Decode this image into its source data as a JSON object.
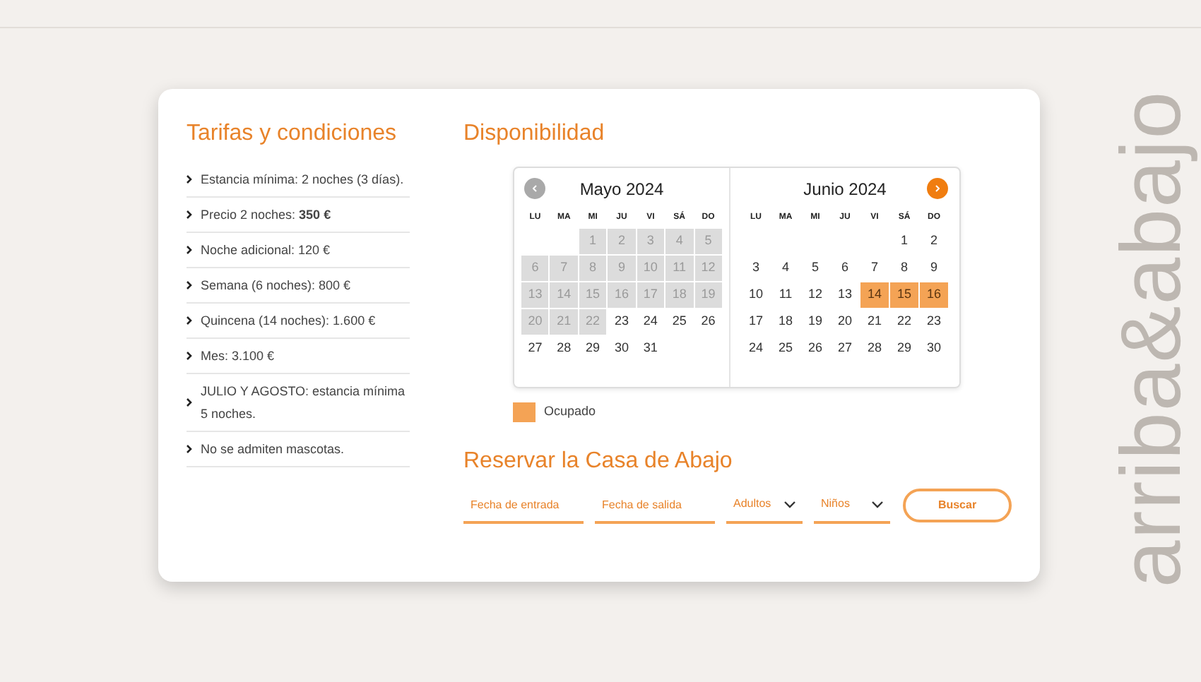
{
  "brand": "arriba&abajo",
  "rates": {
    "title": "Tarifas y condiciones",
    "items": [
      "Estancia mínima: 2 noches (3 días).",
      "Precio 2 noches: **350 €**",
      "Noche adicional: 120 €",
      "Semana (6 noches): 800 €",
      "Quincena (14 noches): 1.600 €",
      "Mes: 3.100 €",
      "JULIO Y AGOSTO: estancia mínima 5 noches.",
      "No se admiten mascotas."
    ]
  },
  "availability": {
    "title": "Disponibilidad",
    "prev_enabled": false,
    "next_enabled": true,
    "months": [
      {
        "title": "Mayo 2024",
        "weekdays": [
          "LU",
          "MA",
          "MI",
          "JU",
          "VI",
          "SÁ",
          "DO"
        ],
        "weeks": [
          [
            {
              "d": "1",
              "disabled": true,
              "occupied": false
            },
            {
              "d": "2",
              "disabled": true,
              "occupied": false
            },
            {
              "d": "3",
              "disabled": true,
              "occupied": false
            },
            {
              "d": "4",
              "disabled": true,
              "occupied": false
            },
            {
              "d": "5",
              "disabled": true,
              "occupied": false
            }
          ],
          [
            {
              "d": "6",
              "disabled": true,
              "occupied": false
            },
            {
              "d": "7",
              "disabled": true,
              "occupied": false
            },
            {
              "d": "8",
              "disabled": true,
              "occupied": false
            },
            {
              "d": "9",
              "disabled": true,
              "occupied": false
            },
            {
              "d": "10",
              "disabled": true,
              "occupied": false
            },
            {
              "d": "11",
              "disabled": true,
              "occupied": false
            },
            {
              "d": "12",
              "disabled": true,
              "occupied": false
            }
          ],
          [
            {
              "d": "13",
              "disabled": true,
              "occupied": false
            },
            {
              "d": "14",
              "disabled": true,
              "occupied": false
            },
            {
              "d": "15",
              "disabled": true,
              "occupied": false
            },
            {
              "d": "16",
              "disabled": true,
              "occupied": false
            },
            {
              "d": "17",
              "disabled": true,
              "occupied": false
            },
            {
              "d": "18",
              "disabled": true,
              "occupied": false
            },
            {
              "d": "19",
              "disabled": true,
              "occupied": false
            }
          ],
          [
            {
              "d": "20",
              "disabled": true,
              "occupied": false
            },
            {
              "d": "21",
              "disabled": true,
              "occupied": false
            },
            {
              "d": "22",
              "disabled": true,
              "occupied": false
            },
            {
              "d": "23",
              "disabled": false,
              "occupied": false
            },
            {
              "d": "24",
              "disabled": false,
              "occupied": false
            },
            {
              "d": "25",
              "disabled": false,
              "occupied": false
            },
            {
              "d": "26",
              "disabled": false,
              "occupied": false
            }
          ],
          [
            {
              "d": "27",
              "disabled": false,
              "occupied": false
            },
            {
              "d": "28",
              "disabled": false,
              "occupied": false
            },
            {
              "d": "29",
              "disabled": false,
              "occupied": false
            },
            {
              "d": "30",
              "disabled": false,
              "occupied": false
            },
            {
              "d": "31",
              "disabled": false,
              "occupied": false
            }
          ]
        ]
      },
      {
        "title": "Junio 2024",
        "weekdays": [
          "LU",
          "MA",
          "MI",
          "JU",
          "VI",
          "SÁ",
          "DO"
        ],
        "weeks": [
          [
            {
              "d": "1",
              "disabled": false,
              "occupied": false
            },
            {
              "d": "2",
              "disabled": false,
              "occupied": false
            }
          ],
          [
            {
              "d": "3",
              "disabled": false,
              "occupied": false
            },
            {
              "d": "4",
              "disabled": false,
              "occupied": false
            },
            {
              "d": "5",
              "disabled": false,
              "occupied": false
            },
            {
              "d": "6",
              "disabled": false,
              "occupied": false
            },
            {
              "d": "7",
              "disabled": false,
              "occupied": false
            },
            {
              "d": "8",
              "disabled": false,
              "occupied": false
            },
            {
              "d": "9",
              "disabled": false,
              "occupied": false
            }
          ],
          [
            {
              "d": "10",
              "disabled": false,
              "occupied": false
            },
            {
              "d": "11",
              "disabled": false,
              "occupied": false
            },
            {
              "d": "12",
              "disabled": false,
              "occupied": false
            },
            {
              "d": "13",
              "disabled": false,
              "occupied": false
            },
            {
              "d": "14",
              "disabled": false,
              "occupied": true
            },
            {
              "d": "15",
              "disabled": false,
              "occupied": true
            },
            {
              "d": "16",
              "disabled": false,
              "occupied": true
            }
          ],
          [
            {
              "d": "17",
              "disabled": false,
              "occupied": false
            },
            {
              "d": "18",
              "disabled": false,
              "occupied": false
            },
            {
              "d": "19",
              "disabled": false,
              "occupied": false
            },
            {
              "d": "20",
              "disabled": false,
              "occupied": false
            },
            {
              "d": "21",
              "disabled": false,
              "occupied": false
            },
            {
              "d": "22",
              "disabled": false,
              "occupied": false
            },
            {
              "d": "23",
              "disabled": false,
              "occupied": false
            }
          ],
          [
            {
              "d": "24",
              "disabled": false,
              "occupied": false
            },
            {
              "d": "25",
              "disabled": false,
              "occupied": false
            },
            {
              "d": "26",
              "disabled": false,
              "occupied": false
            },
            {
              "d": "27",
              "disabled": false,
              "occupied": false
            },
            {
              "d": "28",
              "disabled": false,
              "occupied": false
            },
            {
              "d": "29",
              "disabled": false,
              "occupied": false
            },
            {
              "d": "30",
              "disabled": false,
              "occupied": false
            }
          ]
        ]
      }
    ],
    "legend": {
      "label": "Ocupado",
      "color": "#f4a355"
    }
  },
  "booking": {
    "title": "Reservar la Casa de Abajo",
    "fields": [
      {
        "kind": "text",
        "placeholder": "Fecha de entrada"
      },
      {
        "kind": "text",
        "placeholder": "Fecha de salida"
      },
      {
        "kind": "select",
        "value": "Adultos"
      },
      {
        "kind": "select",
        "value": "Niños"
      }
    ],
    "button": "Buscar"
  }
}
